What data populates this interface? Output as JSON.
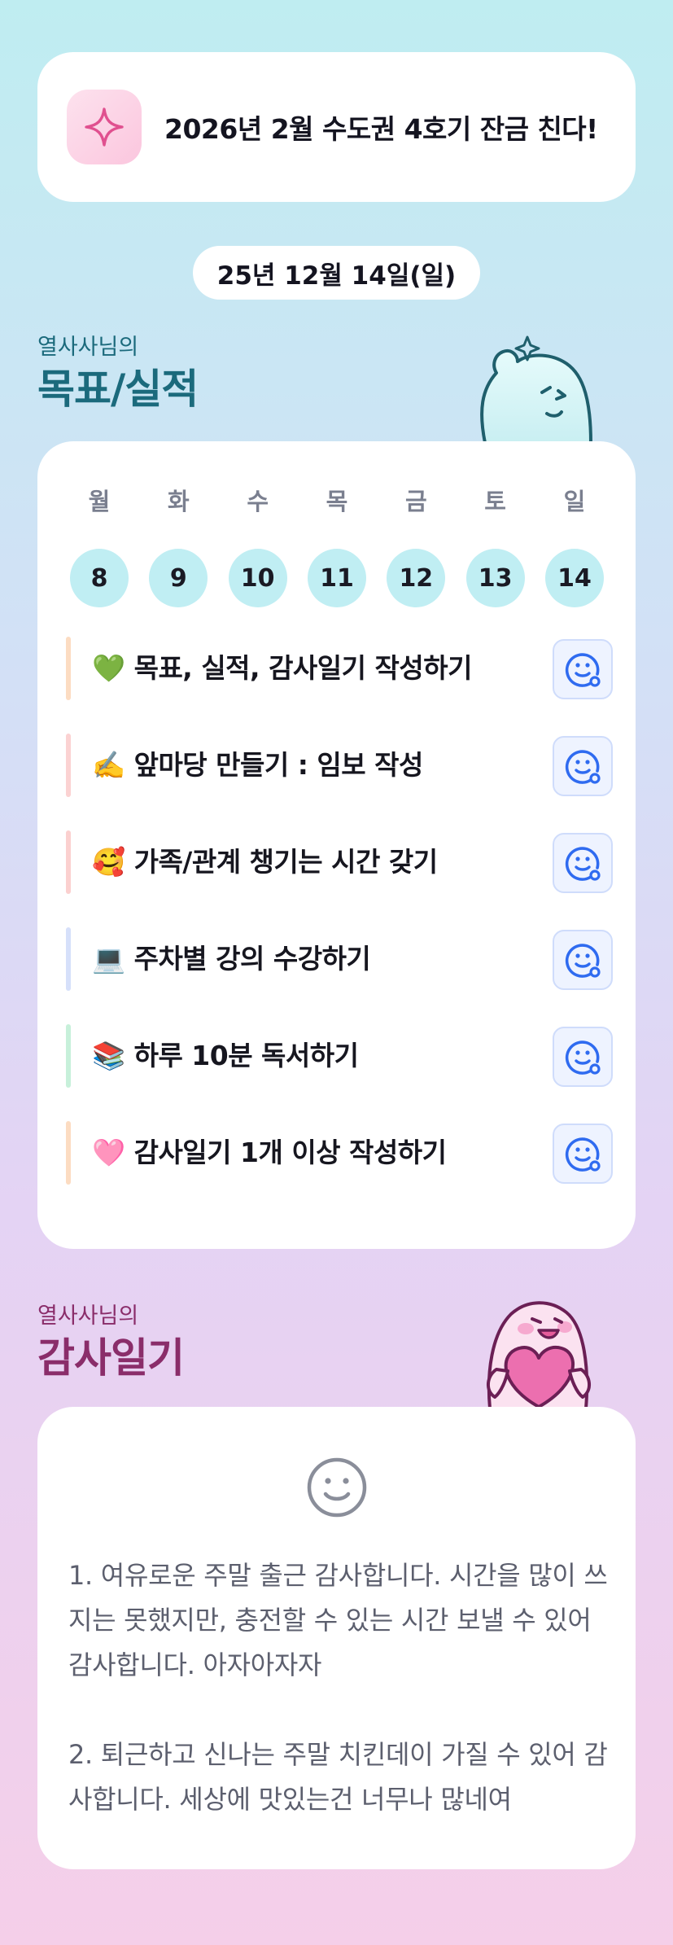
{
  "goal_banner": {
    "icon": "sparkle-icon",
    "text": "2026년 2월 수도권 4호기 잔금 친다!"
  },
  "date": "25년 12월 14일(일)",
  "goals_section": {
    "subtitle": "열사사님의",
    "title": "목표/실적"
  },
  "week": {
    "days": [
      {
        "label": "월",
        "num": "8"
      },
      {
        "label": "화",
        "num": "9"
      },
      {
        "label": "수",
        "num": "10"
      },
      {
        "label": "목",
        "num": "11"
      },
      {
        "label": "금",
        "num": "12"
      },
      {
        "label": "토",
        "num": "13"
      },
      {
        "label": "일",
        "num": "14"
      }
    ]
  },
  "tasks": [
    {
      "label": "💚 목표, 실적, 감사일기 작성하기",
      "bar_color": "#fcdcc2"
    },
    {
      "label": "✍️ 앞마당 만들기 : 임보 작성",
      "bar_color": "#fbd2d2"
    },
    {
      "label": "🥰 가족/관계 챙기는 시간 갖기",
      "bar_color": "#fbd0cf"
    },
    {
      "label": "💻 주차별 강의 수강하기",
      "bar_color": "#d6e0fa"
    },
    {
      "label": "📚 하루 10분 독서하기",
      "bar_color": "#c7f0da"
    },
    {
      "label": "🩷 감사일기 1개 이상 작성하기",
      "bar_color": "#fcdcc2"
    }
  ],
  "task_button_icon": "smile-status-icon",
  "diary_section": {
    "subtitle": "열사사님의",
    "title": "감사일기"
  },
  "diary": {
    "icon": "smiley-icon",
    "text": "1. 여유로운 주말 출근 감사합니다. 시간을 많이 쓰지는 못했지만, 충전할 수 있는 시간 보낼 수 있어 감사합니다. 아자아자자\n\n2. 퇴근하고 신나는 주말 치킨데이 가질 수 있어 감사합니다. 세상에 맛있는건 너무나 많네여"
  }
}
